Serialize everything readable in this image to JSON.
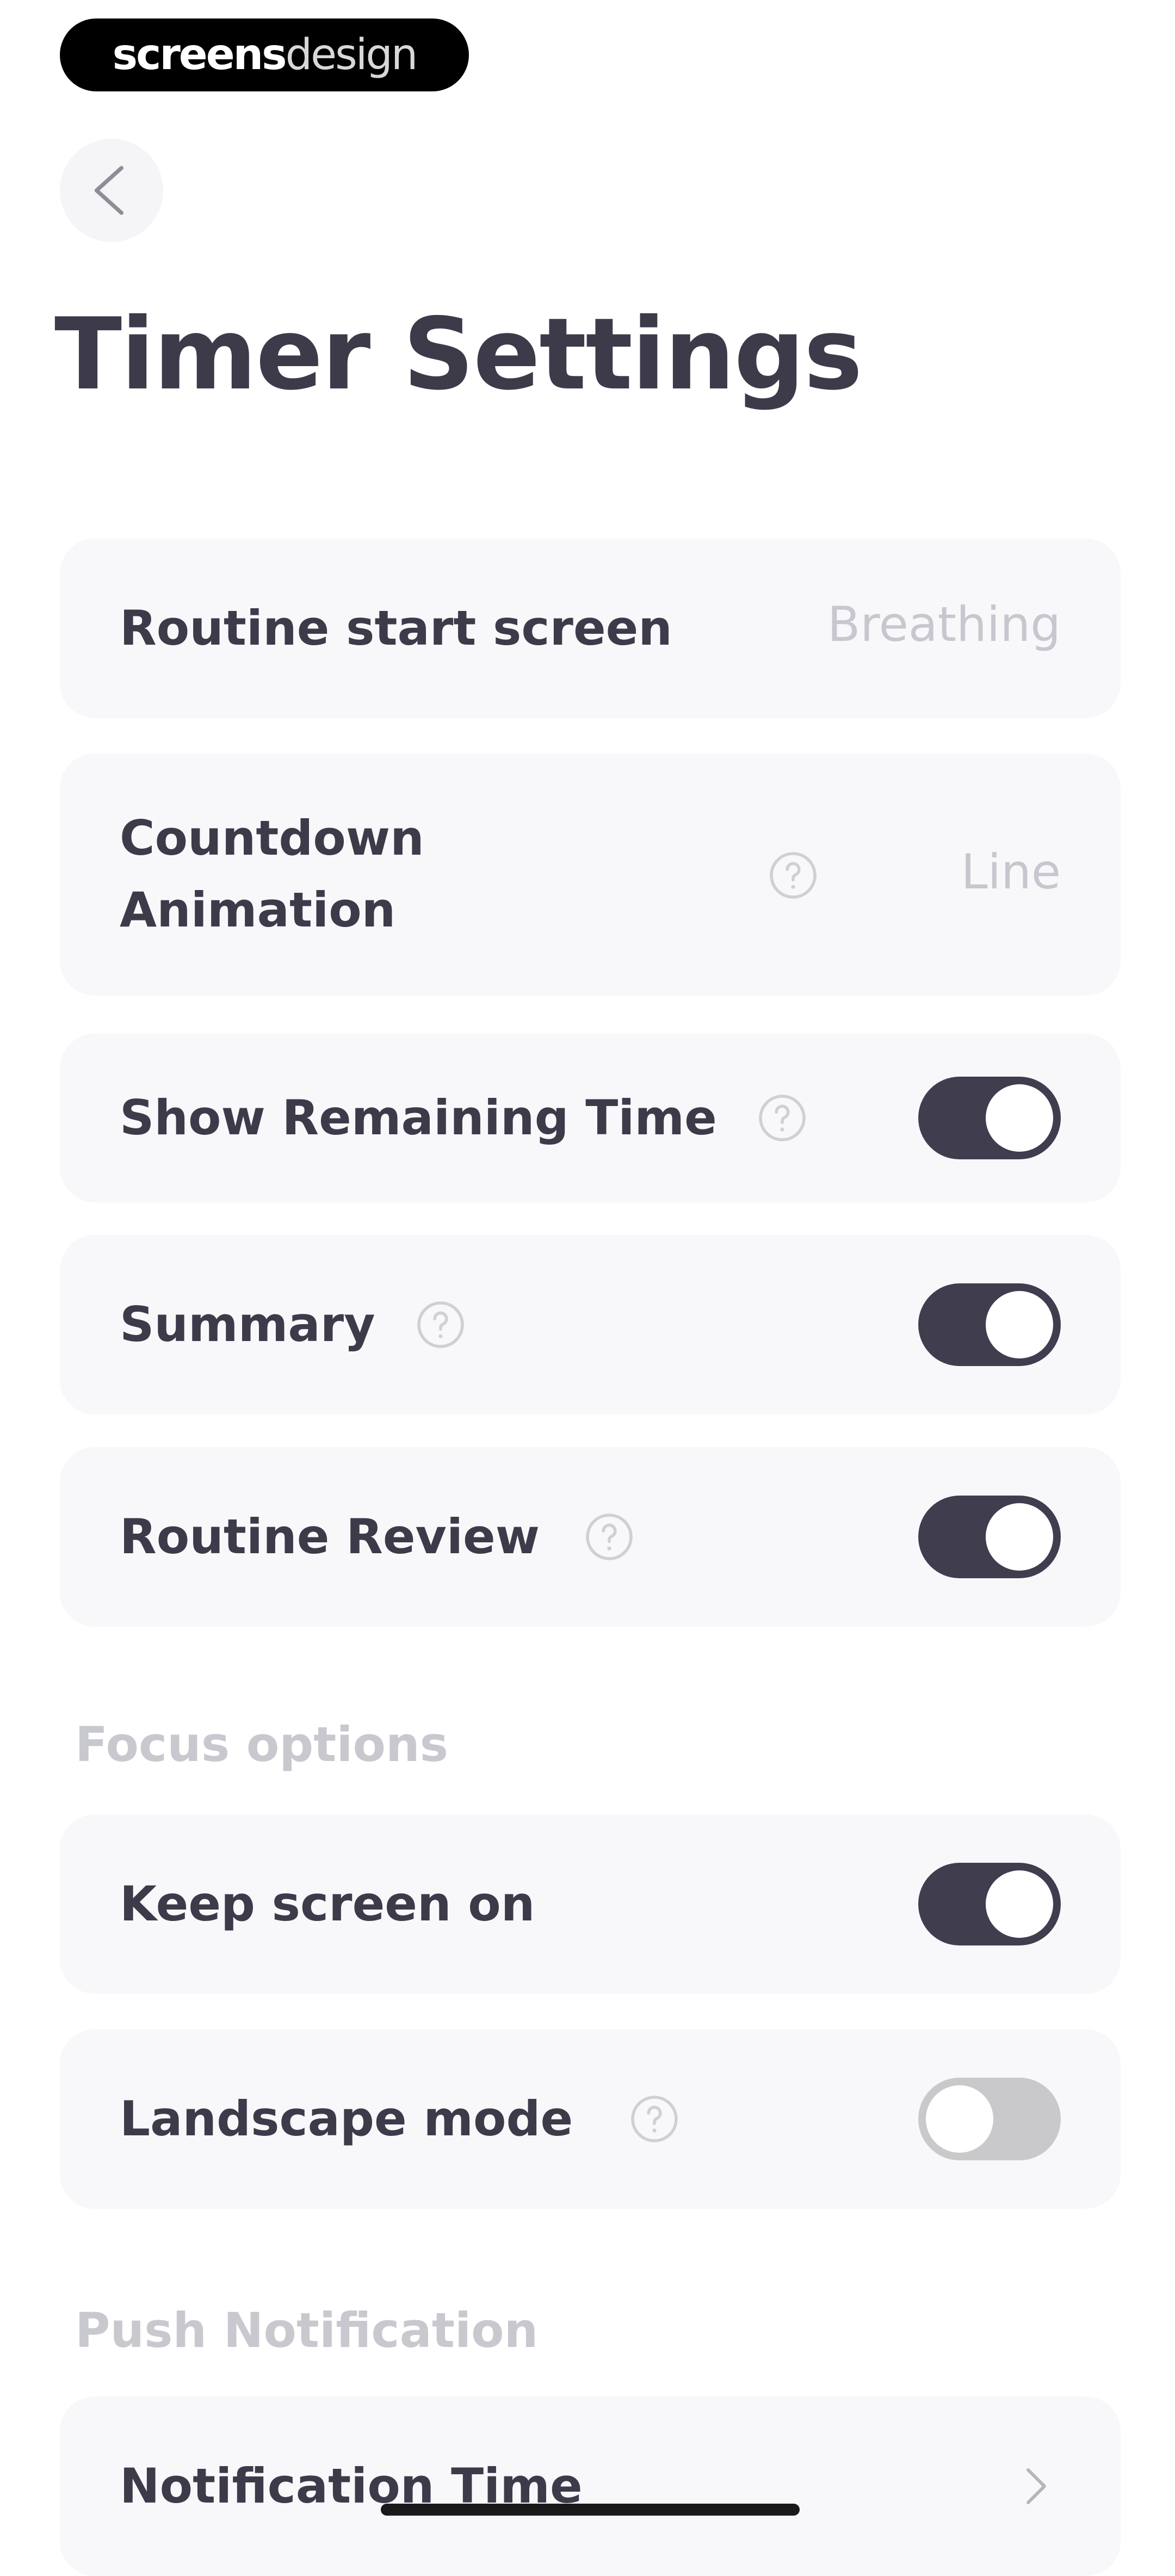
{
  "watermark": {
    "part_bold": "screens",
    "part_light": "design"
  },
  "header": {
    "back_icon": "chevron-left-icon",
    "title": "Timer Settings"
  },
  "settings": {
    "routine_start_screen": {
      "label": "Routine start screen",
      "value": "Breathing"
    },
    "countdown_animation": {
      "label": "Countdown Animation",
      "value": "Line",
      "icon": "help-icon"
    },
    "show_remaining_time": {
      "label": "Show Remaining Time",
      "enabled": true,
      "icon": "help-icon"
    },
    "summary": {
      "label": "Summary",
      "enabled": true,
      "icon": "help-icon"
    },
    "routine_review": {
      "label": "Routine Review",
      "enabled": true,
      "icon": "help-icon"
    }
  },
  "focus_options": {
    "header": "Focus options",
    "keep_screen_on": {
      "label": "Keep screen on",
      "enabled": true
    },
    "landscape_mode": {
      "label": "Landscape mode",
      "enabled": false,
      "icon": "help-icon"
    }
  },
  "push_notification": {
    "header": "Push Notification",
    "notification_time": {
      "label": "Notification Time",
      "icon": "chevron-right-icon"
    }
  },
  "colors": {
    "text_primary": "#3d3b4a",
    "text_muted": "#c7c7cf",
    "card_background": "#f8f8fa",
    "toggle_on": "#3f3d4e",
    "toggle_off": "#c9c9cc"
  }
}
